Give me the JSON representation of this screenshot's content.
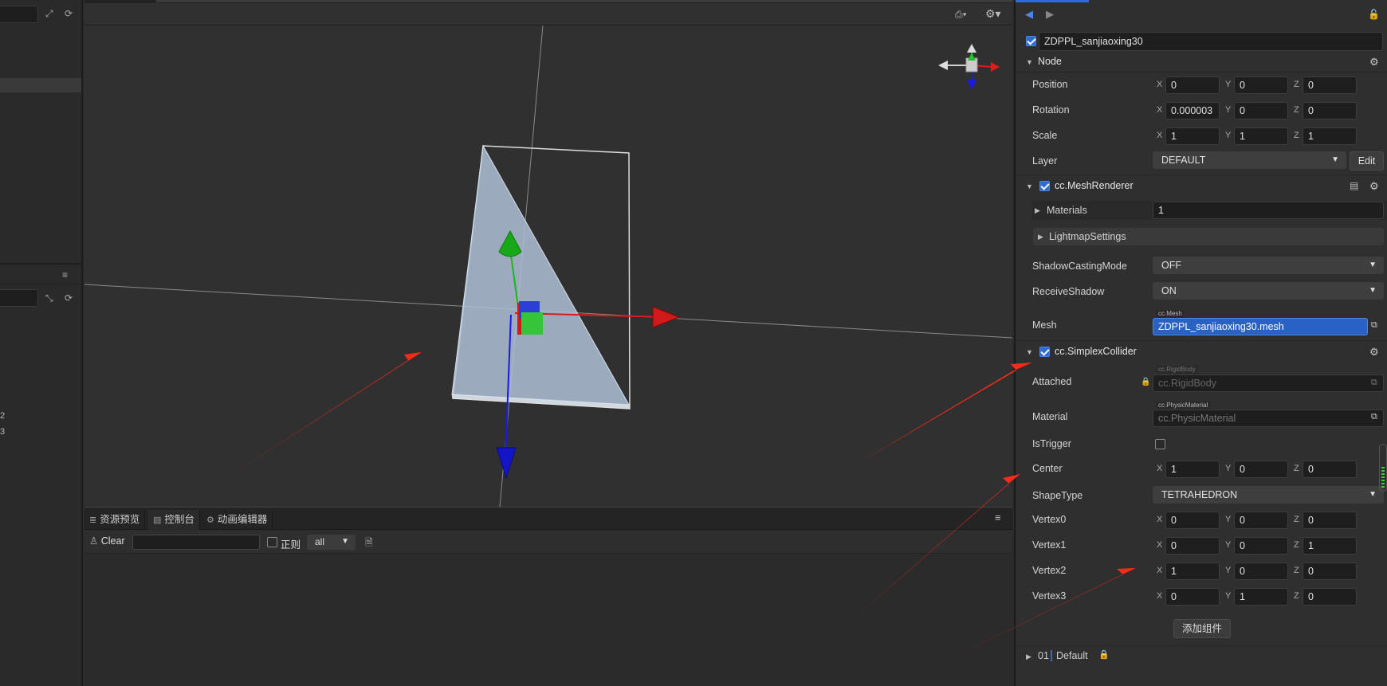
{
  "consoleTabs": [
    {
      "icon": "≣",
      "label": "资源预览"
    },
    {
      "icon": "▤",
      "label": "控制台"
    },
    {
      "icon": "⚙",
      "label": "动画编辑器"
    }
  ],
  "console": {
    "clear": "Clear",
    "regex": "正则",
    "level": "all"
  },
  "leftPanel": {
    "numbers": [
      "2",
      "3"
    ]
  },
  "inspector": {
    "nodeName": "ZDPPL_sanjiaoxing30",
    "node": {
      "title": "Node",
      "position": {
        "label": "Position",
        "x": "0",
        "y": "0",
        "z": "0"
      },
      "rotation": {
        "label": "Rotation",
        "x": "0.000003",
        "y": "0",
        "z": "0"
      },
      "scale": {
        "label": "Scale",
        "x": "1",
        "y": "1",
        "z": "1"
      },
      "layer": {
        "label": "Layer",
        "value": "DEFAULT",
        "edit": "Edit"
      }
    },
    "meshRenderer": {
      "title": "cc.MeshRenderer",
      "materials": {
        "label": "Materials",
        "value": "1"
      },
      "lightmap": "LightmapSettings",
      "shadowCasting": {
        "label": "ShadowCastingMode",
        "value": "OFF"
      },
      "receiveShadow": {
        "label": "ReceiveShadow",
        "value": "ON"
      },
      "mesh": {
        "label": "Mesh",
        "tag": "cc.Mesh",
        "value": "ZDPPL_sanjiaoxing30.mesh"
      }
    },
    "collider": {
      "title": "cc.SimplexCollider",
      "attached": {
        "label": "Attached",
        "tag": "cc.RigidBody",
        "value": "cc.RigidBody"
      },
      "material": {
        "label": "Material",
        "tag": "cc.PhysicMaterial",
        "value": "cc.PhysicMaterial"
      },
      "isTrigger": {
        "label": "IsTrigger"
      },
      "center": {
        "label": "Center",
        "x": "1",
        "y": "0",
        "z": "0"
      },
      "shapeType": {
        "label": "ShapeType",
        "value": "TETRAHEDRON"
      },
      "vertex0": {
        "label": "Vertex0",
        "x": "0",
        "y": "0",
        "z": "0"
      },
      "vertex1": {
        "label": "Vertex1",
        "x": "0",
        "y": "0",
        "z": "1"
      },
      "vertex2": {
        "label": "Vertex2",
        "x": "1",
        "y": "0",
        "z": "0"
      },
      "vertex3": {
        "label": "Vertex3",
        "x": "0",
        "y": "1",
        "z": "0"
      }
    },
    "addComponent": "添加组件",
    "footer": {
      "prefix": "01",
      "label": "Default"
    },
    "axes": {
      "x": "X",
      "y": "Y",
      "z": "Z"
    }
  },
  "colors": {
    "accent": "#2f6bd0",
    "annotationArrow": "#ff2a1a",
    "gizmoX": "#e01b1b",
    "gizmoY": "#1fb51f",
    "gizmoZ": "#1a1ae0"
  }
}
